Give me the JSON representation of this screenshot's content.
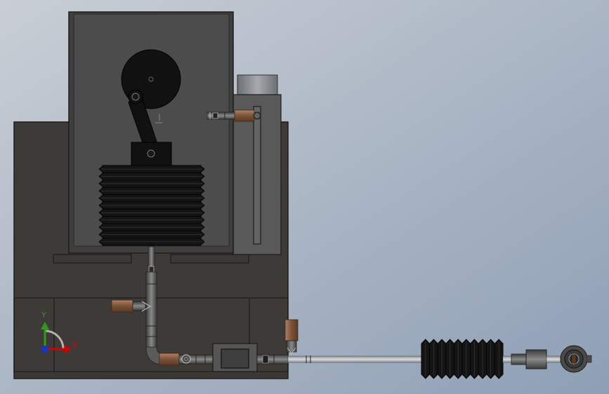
{
  "viewport": {
    "background_top": "#c9ced5",
    "background_bottom": "#8e9fb5"
  },
  "colors": {
    "housing_dark": "#3d3a37",
    "housing_edge": "#1e1c1b",
    "cabinet_fill": "#4a4a4a",
    "tank_fill": "#595959",
    "black_part": "#111111",
    "copper": "#8a6247",
    "pipe": "#666666",
    "rod": "#b9bcc0",
    "axis_x": "#d40000",
    "axis_y": "#2e9a1a",
    "axis_z": "#1a33c9"
  },
  "triad": {
    "x_label": "X",
    "y_label": "Y",
    "x_icon": "axis-x-arrow-icon",
    "y_icon": "axis-y-arrow-icon",
    "z_icon": "axis-z-dot-icon"
  },
  "assembly": {
    "bellows_main_folds": 11,
    "bellows_right_folds": 10
  }
}
